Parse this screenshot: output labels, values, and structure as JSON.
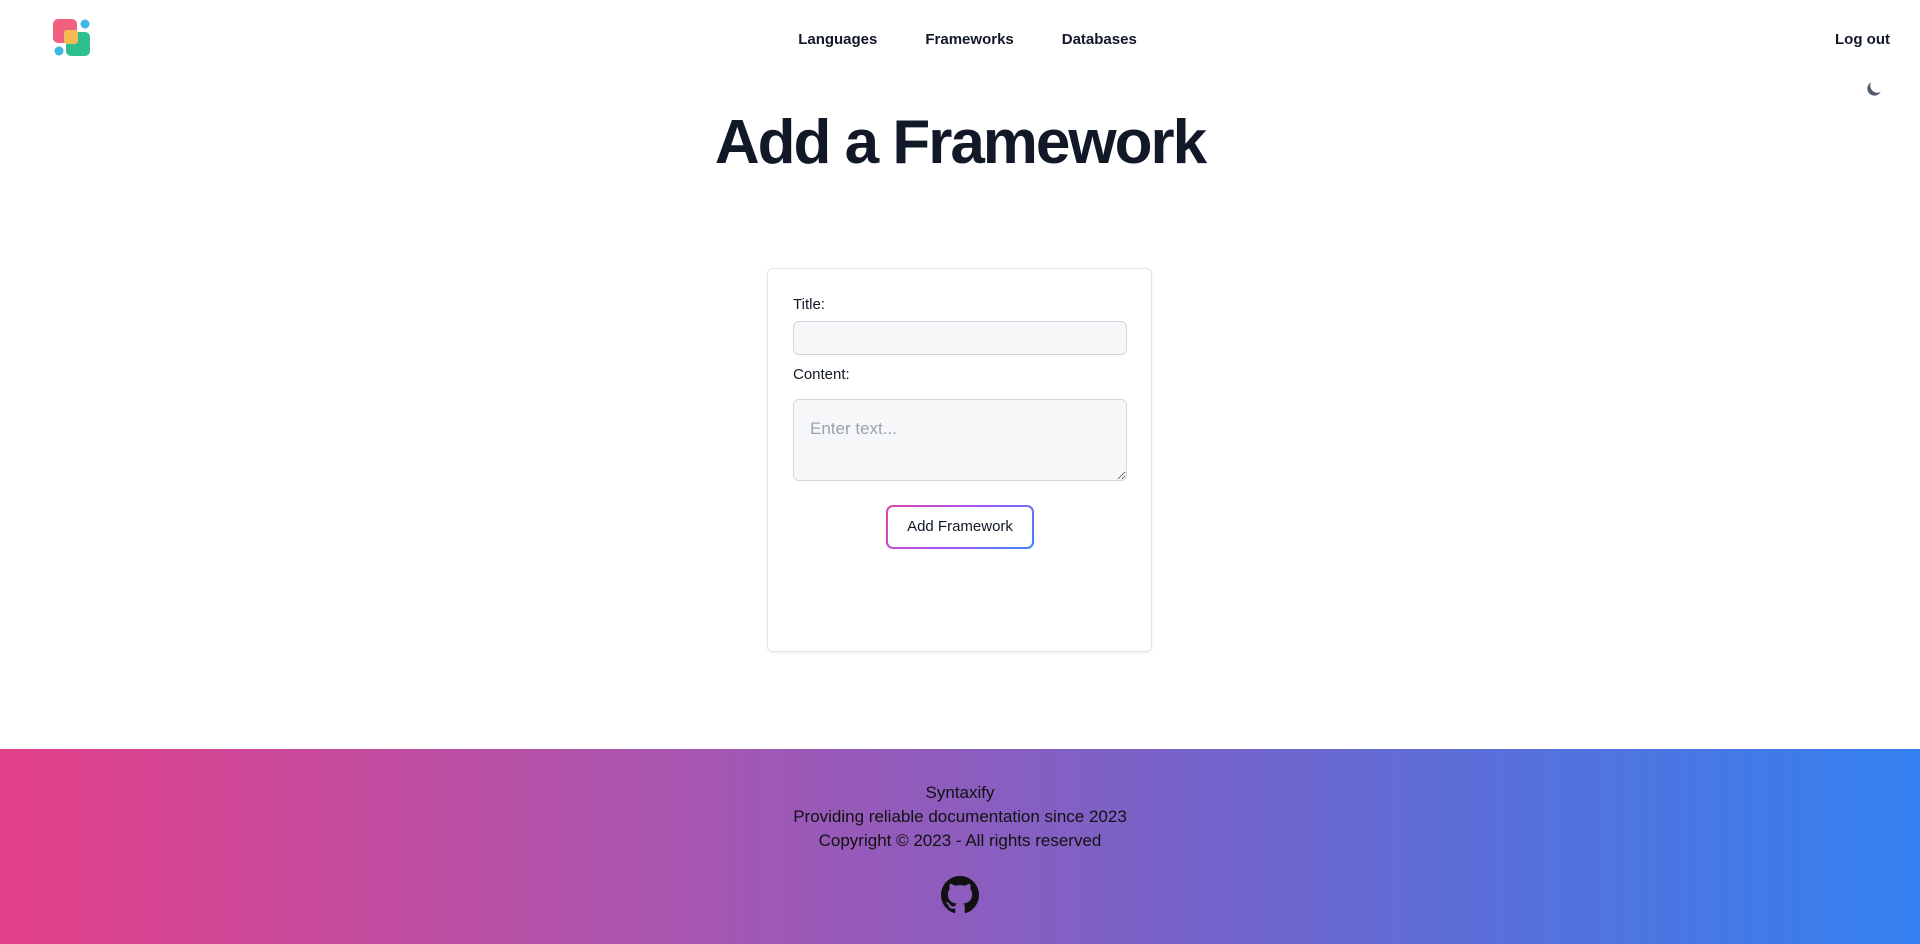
{
  "nav": {
    "items": [
      "Languages",
      "Frameworks",
      "Databases"
    ],
    "logout": "Log out"
  },
  "page": {
    "title": "Add a Framework"
  },
  "form": {
    "title_label": "Title:",
    "title_value": "",
    "content_label": "Content:",
    "content_placeholder": "Enter text...",
    "submit_label": "Add Framework"
  },
  "footer": {
    "brand": "Syntaxify",
    "tagline": "Providing reliable documentation since 2023",
    "copyright": "Copyright © 2023 - All rights reserved"
  },
  "icons": {
    "logo": "app-logo",
    "theme_toggle": "moon-icon",
    "github": "github-icon"
  },
  "colors": {
    "footer_gradient_start": "#e33f88",
    "footer_gradient_end": "#3380f0",
    "button_border_start": "#d946a8",
    "button_border_end": "#3b82f6"
  }
}
